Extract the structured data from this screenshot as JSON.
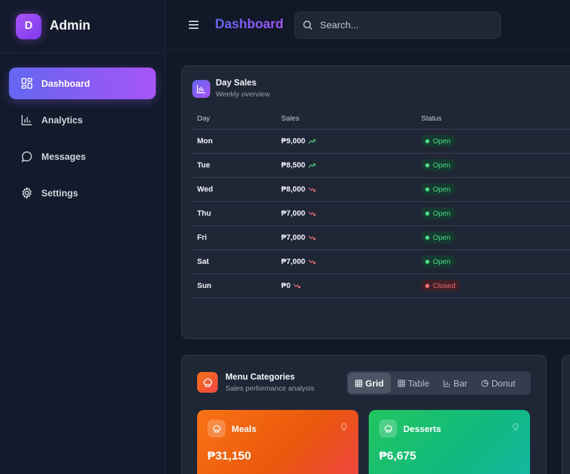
{
  "sidebar": {
    "brand_initial": "D",
    "brand_name": "Admin",
    "items": [
      {
        "label": "Dashboard",
        "icon": "grid-icon",
        "active": true
      },
      {
        "label": "Analytics",
        "icon": "bar-chart-icon",
        "active": false
      },
      {
        "label": "Messages",
        "icon": "message-icon",
        "active": false
      },
      {
        "label": "Settings",
        "icon": "gear-icon",
        "active": false
      }
    ]
  },
  "header": {
    "title": "Dashboard",
    "search_placeholder": "Search..."
  },
  "day_sales": {
    "title": "Day Sales",
    "subtitle": "Weekly overview",
    "columns": [
      "Day",
      "Sales",
      "Status"
    ],
    "rows": [
      {
        "day": "Mon",
        "sales": "₱9,000",
        "trend": "up",
        "status": "Open"
      },
      {
        "day": "Tue",
        "sales": "₱8,500",
        "trend": "up",
        "status": "Open"
      },
      {
        "day": "Wed",
        "sales": "₱8,000",
        "trend": "down",
        "status": "Open"
      },
      {
        "day": "Thu",
        "sales": "₱7,000",
        "trend": "down",
        "status": "Open"
      },
      {
        "day": "Fri",
        "sales": "₱7,000",
        "trend": "down",
        "status": "Open"
      },
      {
        "day": "Sat",
        "sales": "₱7,000",
        "trend": "down",
        "status": "Open"
      },
      {
        "day": "Sun",
        "sales": "₱0",
        "trend": "down",
        "status": "Closed"
      }
    ]
  },
  "menu_categories": {
    "title": "Menu Categories",
    "subtitle": "Sales performance analysis",
    "views": [
      "Grid",
      "Table",
      "Bar",
      "Donut"
    ],
    "active_view": "Grid",
    "tiles": [
      {
        "name": "Meals",
        "value": "₱31,150"
      },
      {
        "name": "Desserts",
        "value": "₱6,675"
      }
    ]
  },
  "colors": {
    "accent_start": "#6366f1",
    "accent_end": "#a855f7",
    "open": "#4ade80",
    "closed": "#f87171"
  }
}
